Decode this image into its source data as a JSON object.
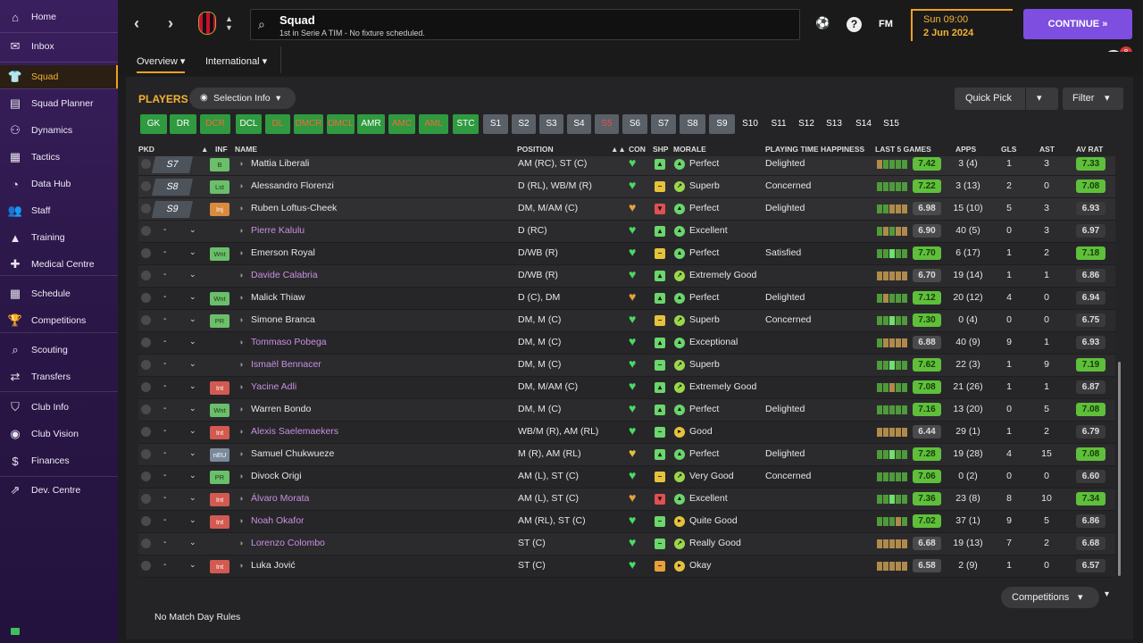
{
  "sidebar": {
    "items": [
      {
        "label": "Home",
        "icon": "home-icon",
        "glyph": "⌂"
      },
      {
        "label": "Inbox",
        "icon": "inbox-icon",
        "glyph": "✉"
      },
      {
        "label": "Squad",
        "icon": "shirt-icon",
        "glyph": "👕"
      },
      {
        "label": "Squad Planner",
        "icon": "planner-icon",
        "glyph": "▤"
      },
      {
        "label": "Dynamics",
        "icon": "dynamics-icon",
        "glyph": "⚇"
      },
      {
        "label": "Tactics",
        "icon": "tactics-icon",
        "glyph": "▦"
      },
      {
        "label": "Data Hub",
        "icon": "datahub-icon",
        "glyph": "◔"
      },
      {
        "label": "Staff",
        "icon": "staff-icon",
        "glyph": "👥"
      },
      {
        "label": "Training",
        "icon": "training-icon",
        "glyph": "▲"
      },
      {
        "label": "Medical Centre",
        "icon": "medical-icon",
        "glyph": "✚"
      },
      {
        "label": "Schedule",
        "icon": "calendar-icon",
        "glyph": "▦"
      },
      {
        "label": "Competitions",
        "icon": "trophy-icon",
        "glyph": "🏆"
      },
      {
        "label": "Scouting",
        "icon": "scouting-icon",
        "glyph": "⌕"
      },
      {
        "label": "Transfers",
        "icon": "transfers-icon",
        "glyph": "⇄"
      },
      {
        "label": "Club Info",
        "icon": "shield-icon",
        "glyph": "⛉"
      },
      {
        "label": "Club Vision",
        "icon": "vision-icon",
        "glyph": "◉"
      },
      {
        "label": "Finances",
        "icon": "finances-icon",
        "glyph": "$"
      },
      {
        "label": "Dev. Centre",
        "icon": "devcentre-icon",
        "glyph": "⇗"
      }
    ]
  },
  "header": {
    "title": "Squad",
    "subtitle": "1st in Serie A TIM - No fixture scheduled.",
    "fm_label": "FM",
    "time": "Sun 09:00",
    "date": "2 Jun 2024",
    "continue_label": "CONTINUE",
    "notification_count": "8"
  },
  "subtabs": [
    "Overview",
    "International"
  ],
  "toolbar": {
    "players_label": "PLAYERS",
    "selection_info": "Selection Info",
    "quick_pick": "Quick Pick",
    "filter": "Filter"
  },
  "chips": [
    {
      "label": "GK",
      "kind": "green"
    },
    {
      "label": "DR",
      "kind": "green"
    },
    {
      "label": "DCR",
      "kind": "green dim"
    },
    {
      "label": "DCL",
      "kind": "green"
    },
    {
      "label": "DL",
      "kind": "green dim"
    },
    {
      "label": "DMCR",
      "kind": "green dim"
    },
    {
      "label": "DMCL",
      "kind": "green dim"
    },
    {
      "label": "AMR",
      "kind": "green"
    },
    {
      "label": "AMC",
      "kind": "green dim"
    },
    {
      "label": "AML",
      "kind": "green dim"
    },
    {
      "label": "STC",
      "kind": "green"
    },
    {
      "label": "S1",
      "kind": "grey"
    },
    {
      "label": "S2",
      "kind": "grey"
    },
    {
      "label": "S3",
      "kind": "grey"
    },
    {
      "label": "S4",
      "kind": "grey"
    },
    {
      "label": "S5",
      "kind": "grey dim"
    },
    {
      "label": "S6",
      "kind": "grey"
    },
    {
      "label": "S7",
      "kind": "grey"
    },
    {
      "label": "S8",
      "kind": "grey"
    },
    {
      "label": "S9",
      "kind": "grey"
    },
    {
      "label": "S10",
      "kind": "plain"
    },
    {
      "label": "S11",
      "kind": "plain"
    },
    {
      "label": "S12",
      "kind": "plain"
    },
    {
      "label": "S13",
      "kind": "plain"
    },
    {
      "label": "S14",
      "kind": "plain"
    },
    {
      "label": "S15",
      "kind": "plain"
    }
  ],
  "table": {
    "columns": [
      "PKD",
      "INF",
      "NAME",
      "POSITION",
      "CON",
      "SHP",
      "MORALE",
      "PLAYING TIME HAPPINESS",
      "LAST 5 GAMES",
      "APPS",
      "GLS",
      "AST",
      "AV RAT"
    ],
    "rows": [
      {
        "slot": "S7",
        "inf": "B",
        "name": "Mattia Liberali",
        "loan": false,
        "pos": "AM (RC), ST (C)",
        "con": "green",
        "shp": "up",
        "mor_ico": "up",
        "morale": "Perfect",
        "pth": "Delighted",
        "last5": "7.42",
        "last5_good": true,
        "form": [
          "o",
          "g",
          "g",
          "g",
          "g"
        ],
        "apps": "3 (4)",
        "gls": "1",
        "ast": "3",
        "av": "7.33",
        "av_good": true
      },
      {
        "slot": "S8",
        "inf": "Lst",
        "name": "Alessandro Florenzi",
        "loan": false,
        "pos": "D (RL), WB/M (R)",
        "con": "green",
        "shp": "neutral",
        "mor_ico": "up-right",
        "morale": "Superb",
        "pth": "Concerned",
        "last5": "7.22",
        "last5_good": true,
        "form": [
          "g",
          "g",
          "g",
          "g",
          "g"
        ],
        "apps": "3 (13)",
        "gls": "2",
        "ast": "0",
        "av": "7.08",
        "av_good": true
      },
      {
        "slot": "S9",
        "inf": "Inj",
        "name": "Ruben Loftus-Cheek",
        "loan": false,
        "pos": "DM, M/AM (C)",
        "con": "orange",
        "shp": "down",
        "mor_ico": "up",
        "morale": "Perfect",
        "pth": "Delighted",
        "last5": "6.98",
        "last5_good": false,
        "form": [
          "g",
          "g",
          "o",
          "o",
          "o"
        ],
        "apps": "15 (10)",
        "gls": "5",
        "ast": "3",
        "av": "6.93",
        "av_good": false
      },
      {
        "slot": "",
        "inf": "",
        "name": "Pierre Kalulu",
        "loan": true,
        "pos": "D (RC)",
        "con": "green",
        "shp": "green-up",
        "mor_ico": "up",
        "morale": "Excellent",
        "pth": "",
        "last5": "6.90",
        "last5_good": false,
        "form": [
          "g",
          "o",
          "g",
          "o",
          "o"
        ],
        "apps": "40 (5)",
        "gls": "0",
        "ast": "3",
        "av": "6.97",
        "av_good": false
      },
      {
        "slot": "",
        "inf": "Wnt",
        "name": "Emerson Royal",
        "loan": false,
        "pos": "D/WB (R)",
        "con": "green",
        "shp": "neutral",
        "mor_ico": "up",
        "morale": "Perfect",
        "pth": "Satisfied",
        "last5": "7.70",
        "last5_good": true,
        "form": [
          "g",
          "g",
          "G",
          "g",
          "g"
        ],
        "apps": "6 (17)",
        "gls": "1",
        "ast": "2",
        "av": "7.18",
        "av_good": true
      },
      {
        "slot": "",
        "inf": "",
        "name": "Davide Calabria",
        "loan": true,
        "pos": "D/WB (R)",
        "con": "green",
        "shp": "green-up",
        "mor_ico": "up-right",
        "morale": "Extremely Good",
        "pth": "",
        "last5": "6.70",
        "last5_good": false,
        "form": [
          "o",
          "o",
          "o",
          "o",
          "o"
        ],
        "apps": "19 (14)",
        "gls": "1",
        "ast": "1",
        "av": "6.86",
        "av_good": false
      },
      {
        "slot": "",
        "inf": "Wnt",
        "name": "Malick Thiaw",
        "loan": false,
        "pos": "D (C), DM",
        "con": "orange",
        "shp": "green-up",
        "mor_ico": "up",
        "morale": "Perfect",
        "pth": "Delighted",
        "last5": "7.12",
        "last5_good": true,
        "form": [
          "g",
          "o",
          "g",
          "g",
          "g"
        ],
        "apps": "20 (12)",
        "gls": "4",
        "ast": "0",
        "av": "6.94",
        "av_good": false
      },
      {
        "slot": "",
        "inf": "PR",
        "name": "Simone Branca",
        "loan": false,
        "pos": "DM, M (C)",
        "con": "green",
        "shp": "neutral",
        "mor_ico": "up-right",
        "morale": "Superb",
        "pth": "Concerned",
        "last5": "7.30",
        "last5_good": true,
        "form": [
          "g",
          "g",
          "G",
          "g",
          "g"
        ],
        "apps": "0 (4)",
        "gls": "0",
        "ast": "0",
        "av": "6.75",
        "av_good": false
      },
      {
        "slot": "",
        "inf": "",
        "name": "Tommaso Pobega",
        "loan": true,
        "pos": "DM, M (C)",
        "con": "green",
        "shp": "green-up",
        "mor_ico": "up",
        "morale": "Exceptional",
        "pth": "",
        "last5": "6.88",
        "last5_good": false,
        "form": [
          "g",
          "o",
          "o",
          "o",
          "o"
        ],
        "apps": "40 (9)",
        "gls": "9",
        "ast": "1",
        "av": "6.93",
        "av_good": false
      },
      {
        "slot": "",
        "inf": "",
        "name": "Ismaël Bennacer",
        "loan": true,
        "pos": "DM, M (C)",
        "con": "green",
        "shp": "green-flat",
        "mor_ico": "up-right",
        "morale": "Superb",
        "pth": "",
        "last5": "7.62",
        "last5_good": true,
        "form": [
          "g",
          "g",
          "G",
          "g",
          "g"
        ],
        "apps": "22 (3)",
        "gls": "1",
        "ast": "9",
        "av": "7.19",
        "av_good": true
      },
      {
        "slot": "",
        "inf": "Int",
        "name": "Yacine Adli",
        "loan": true,
        "pos": "DM, M/AM (C)",
        "con": "green",
        "shp": "green-up",
        "mor_ico": "up-right",
        "morale": "Extremely Good",
        "pth": "",
        "last5": "7.08",
        "last5_good": true,
        "form": [
          "g",
          "g",
          "o",
          "g",
          "g"
        ],
        "apps": "21 (26)",
        "gls": "1",
        "ast": "1",
        "av": "6.87",
        "av_good": false
      },
      {
        "slot": "",
        "inf": "Wnt",
        "name": "Warren Bondo",
        "loan": false,
        "pos": "DM, M (C)",
        "con": "green",
        "shp": "green-up",
        "mor_ico": "up",
        "morale": "Perfect",
        "pth": "Delighted",
        "last5": "7.16",
        "last5_good": true,
        "form": [
          "g",
          "g",
          "g",
          "g",
          "g"
        ],
        "apps": "13 (20)",
        "gls": "0",
        "ast": "5",
        "av": "7.08",
        "av_good": true
      },
      {
        "slot": "",
        "inf": "Int",
        "name": "Alexis Saelemaekers",
        "loan": true,
        "pos": "WB/M (R), AM (RL)",
        "con": "green",
        "shp": "green-flat",
        "mor_ico": "right",
        "morale": "Good",
        "pth": "",
        "last5": "6.44",
        "last5_good": false,
        "form": [
          "o",
          "o",
          "o",
          "o",
          "o"
        ],
        "apps": "29 (1)",
        "gls": "1",
        "ast": "2",
        "av": "6.79",
        "av_good": false
      },
      {
        "slot": "",
        "inf": "nEU",
        "name": "Samuel Chukwueze",
        "loan": false,
        "pos": "M (R), AM (RL)",
        "con": "yellow",
        "shp": "green-up",
        "mor_ico": "up",
        "morale": "Perfect",
        "pth": "Delighted",
        "last5": "7.28",
        "last5_good": true,
        "form": [
          "g",
          "g",
          "G",
          "g",
          "g"
        ],
        "apps": "19 (28)",
        "gls": "4",
        "ast": "15",
        "av": "7.08",
        "av_good": true
      },
      {
        "slot": "",
        "inf": "PR",
        "name": "Divock Origi",
        "loan": false,
        "pos": "AM (L), ST (C)",
        "con": "green",
        "shp": "neutral",
        "mor_ico": "up-right",
        "morale": "Very Good",
        "pth": "Concerned",
        "last5": "7.06",
        "last5_good": true,
        "form": [
          "g",
          "g",
          "g",
          "g",
          "g"
        ],
        "apps": "0 (2)",
        "gls": "0",
        "ast": "0",
        "av": "6.60",
        "av_good": false
      },
      {
        "slot": "",
        "inf": "Int",
        "name": "Álvaro Morata",
        "loan": true,
        "pos": "AM (L), ST (C)",
        "con": "orange",
        "shp": "down",
        "mor_ico": "up",
        "morale": "Excellent",
        "pth": "",
        "last5": "7.36",
        "last5_good": true,
        "form": [
          "g",
          "g",
          "G",
          "g",
          "g"
        ],
        "apps": "23 (8)",
        "gls": "8",
        "ast": "10",
        "av": "7.34",
        "av_good": true
      },
      {
        "slot": "",
        "inf": "Int",
        "name": "Noah Okafor",
        "loan": true,
        "pos": "AM (RL), ST (C)",
        "con": "green",
        "shp": "green-flat",
        "mor_ico": "right",
        "morale": "Quite Good",
        "pth": "",
        "last5": "7.02",
        "last5_good": true,
        "form": [
          "g",
          "g",
          "g",
          "o",
          "g"
        ],
        "apps": "37 (1)",
        "gls": "9",
        "ast": "5",
        "av": "6.86",
        "av_good": false
      },
      {
        "slot": "",
        "inf": "",
        "name": "Lorenzo Colombo",
        "loan": true,
        "pos": "ST (C)",
        "con": "green",
        "shp": "green-flat",
        "mor_ico": "up-right",
        "morale": "Really Good",
        "pth": "",
        "last5": "6.68",
        "last5_good": false,
        "form": [
          "o",
          "o",
          "o",
          "o",
          "o"
        ],
        "apps": "19 (13)",
        "gls": "7",
        "ast": "2",
        "av": "6.68",
        "av_good": false
      },
      {
        "slot": "",
        "inf": "Int",
        "name": "Luka Jović",
        "loan": false,
        "pos": "ST (C)",
        "con": "green",
        "shp": "orange-flat",
        "mor_ico": "right",
        "morale": "Okay",
        "pth": "",
        "last5": "6.58",
        "last5_good": false,
        "form": [
          "o",
          "o",
          "o",
          "o",
          "o"
        ],
        "apps": "2 (9)",
        "gls": "1",
        "ast": "0",
        "av": "6.57",
        "av_good": false
      }
    ]
  },
  "footer": {
    "competitions": "Competitions",
    "no_match_rules": "No Match Day Rules"
  },
  "colors": {
    "accent": "#f0a020",
    "continue": "#7d4ee0",
    "good_rating": "#5fbf3a",
    "loan_name": "#c890e0"
  }
}
